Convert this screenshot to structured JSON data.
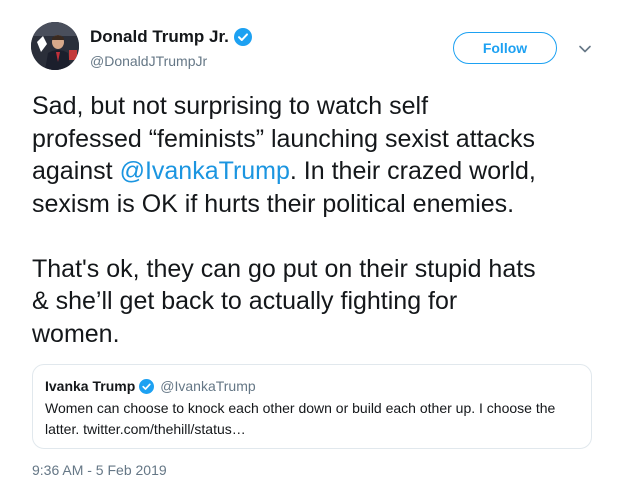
{
  "author": {
    "name": "Donald Trump Jr.",
    "handle": "@DonaldJTrumpJr"
  },
  "follow_label": "Follow",
  "tweet": {
    "text_before": "Sad, but not surprising to watch self\nprofessed “feminists” launching sexist attacks\nagainst ",
    "mention": "@IvankaTrump",
    "text_after": ". In their crazed world,\nsexism is OK if hurts their political enemies.\n\nThat's ok, they can go put on their stupid hats\n& she’ll get back to actually fighting for\nwomen."
  },
  "quoted": {
    "name": "Ivanka Trump",
    "handle": "@IvankaTrump",
    "text": "Women can choose to knock each other down or build each other up. I choose the latter. twitter.com/thehill/status…"
  },
  "timestamp": "9:36 AM - 5 Feb 2019",
  "colors": {
    "accent": "#1da1f2",
    "link": "#1b95e0",
    "muted": "#657786",
    "text": "#14171a",
    "border": "#e1e8ed"
  },
  "icons": [
    "verified-badge-icon",
    "chevron-down-icon"
  ]
}
